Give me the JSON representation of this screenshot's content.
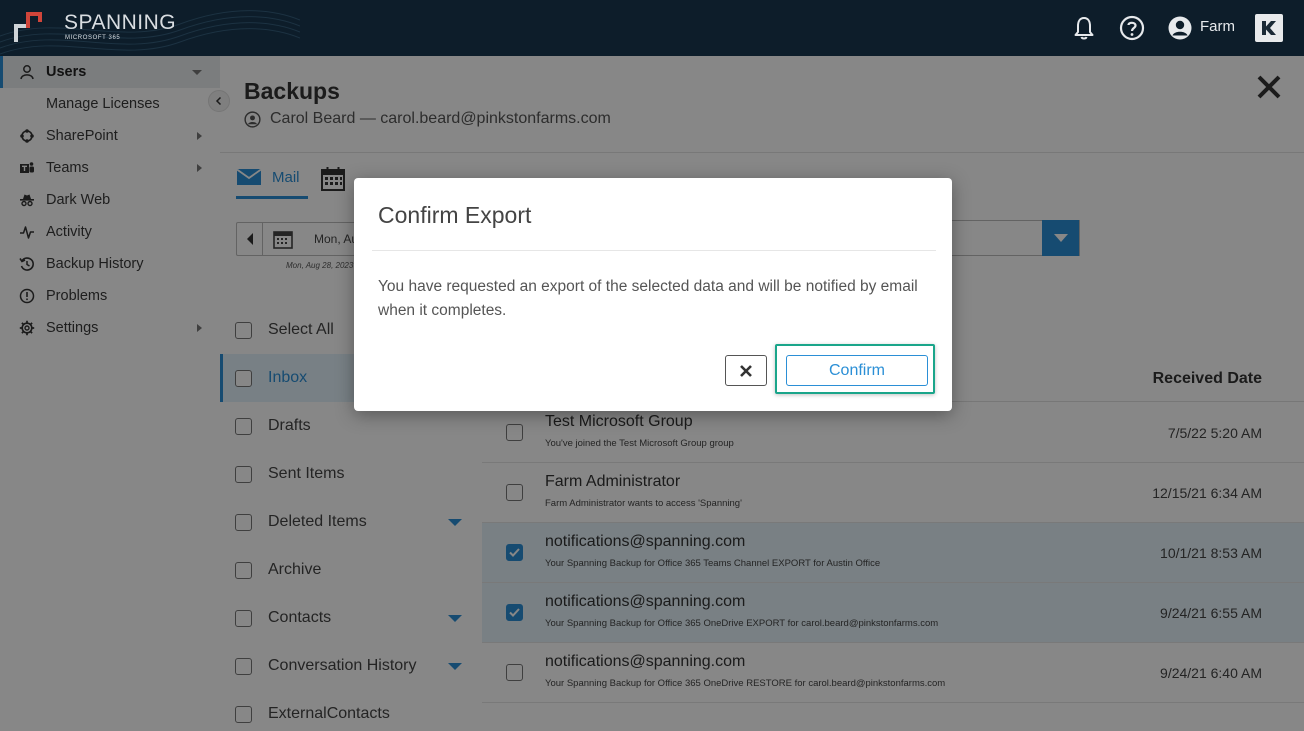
{
  "app": {
    "brand": "SPANNING",
    "brand_sub": "MICROSOFT 365",
    "user_name": "Farm",
    "badge": "K"
  },
  "sidebar": {
    "items": [
      {
        "label": "Users",
        "icon": "user-icon",
        "active": true,
        "arrow": "down"
      },
      {
        "label": "Manage Licenses",
        "icon": "",
        "active": false,
        "arrow": ""
      },
      {
        "label": "SharePoint",
        "icon": "sharepoint-icon",
        "active": false,
        "arrow": "right"
      },
      {
        "label": "Teams",
        "icon": "teams-icon",
        "active": false,
        "arrow": "right"
      },
      {
        "label": "Dark Web",
        "icon": "spy-icon",
        "active": false,
        "arrow": ""
      },
      {
        "label": "Activity",
        "icon": "activity-icon",
        "active": false,
        "arrow": ""
      },
      {
        "label": "Backup History",
        "icon": "history-icon",
        "active": false,
        "arrow": ""
      },
      {
        "label": "Problems",
        "icon": "alert-circle-icon",
        "active": false,
        "arrow": ""
      },
      {
        "label": "Settings",
        "icon": "gear-icon",
        "active": false,
        "arrow": "right"
      }
    ]
  },
  "main": {
    "title": "Backups",
    "subtitle": "Carol Beard — carol.beard@pinkstonfarms.com",
    "tab_mail": "Mail",
    "date_value": "Mon, Au",
    "date_caption": "Mon, Aug 28, 2023"
  },
  "folders": [
    {
      "label": "Select All",
      "selected": false,
      "expandable": false
    },
    {
      "label": "Inbox",
      "selected": true,
      "expandable": false
    },
    {
      "label": "Drafts",
      "selected": false,
      "expandable": false
    },
    {
      "label": "Sent Items",
      "selected": false,
      "expandable": false
    },
    {
      "label": "Deleted Items",
      "selected": false,
      "expandable": true
    },
    {
      "label": "Archive",
      "selected": false,
      "expandable": false
    },
    {
      "label": "Contacts",
      "selected": false,
      "expandable": true
    },
    {
      "label": "Conversation History",
      "selected": false,
      "expandable": true
    },
    {
      "label": "ExternalContacts",
      "selected": false,
      "expandable": false
    }
  ],
  "messages": {
    "col_received": "Received Date",
    "rows": [
      {
        "from": "Test Microsoft Group",
        "snippet": "You've joined the Test Microsoft Group group",
        "date": "7/5/22 5:20 AM",
        "checked": false
      },
      {
        "from": "Farm Administrator",
        "snippet": "Farm Administrator wants to access 'Spanning'",
        "date": "12/15/21 6:34 AM",
        "checked": false
      },
      {
        "from": "notifications@spanning.com",
        "snippet": "Your Spanning Backup for Office 365 Teams Channel EXPORT for Austin Office",
        "date": "10/1/21 8:53 AM",
        "checked": true
      },
      {
        "from": "notifications@spanning.com",
        "snippet": "Your Spanning Backup for Office 365 OneDrive EXPORT for carol.beard@pinkstonfarms.com",
        "date": "9/24/21 6:55 AM",
        "checked": true
      },
      {
        "from": "notifications@spanning.com",
        "snippet": "Your Spanning Backup for Office 365 OneDrive RESTORE for carol.beard@pinkstonfarms.com",
        "date": "9/24/21 6:40 AM",
        "checked": false
      }
    ]
  },
  "modal": {
    "title": "Confirm Export",
    "body": "You have requested an export of the selected data and will be notified by email when it completes.",
    "confirm_label": "Confirm"
  },
  "colors": {
    "accent": "#2b8fd6",
    "topbar": "#0d1d2a",
    "highlight": "#1aa58a",
    "logo_red": "#d0453a"
  }
}
